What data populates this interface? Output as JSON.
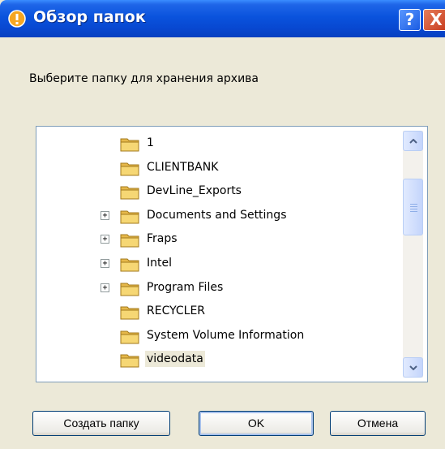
{
  "window": {
    "title": "Обзор папок",
    "help_label": "?",
    "close_label": "X"
  },
  "prompt": "Выберите папку для хранения архива",
  "tree": {
    "items": [
      {
        "label": "1",
        "expander": false
      },
      {
        "label": "CLIENTBANK",
        "expander": false
      },
      {
        "label": "DevLine_Exports",
        "expander": false
      },
      {
        "label": "Documents and Settings",
        "expander": true,
        "expander_symbol": "+"
      },
      {
        "label": "Fraps",
        "expander": true,
        "expander_symbol": "+"
      },
      {
        "label": "Intel",
        "expander": true,
        "expander_symbol": "+"
      },
      {
        "label": "Program Files",
        "expander": true,
        "expander_symbol": "+"
      },
      {
        "label": "RECYCLER",
        "expander": false
      },
      {
        "label": "System Volume Information",
        "expander": false
      },
      {
        "label": "videodata",
        "expander": false,
        "selected": true
      }
    ]
  },
  "buttons": {
    "new_folder": "Создать папку",
    "ok": "OK",
    "cancel": "Отмена"
  },
  "colors": {
    "titlebar": "#0A53DD",
    "dialog_bg": "#ECE9D8",
    "folder": "#F2C94C",
    "close": "#D9502B"
  }
}
